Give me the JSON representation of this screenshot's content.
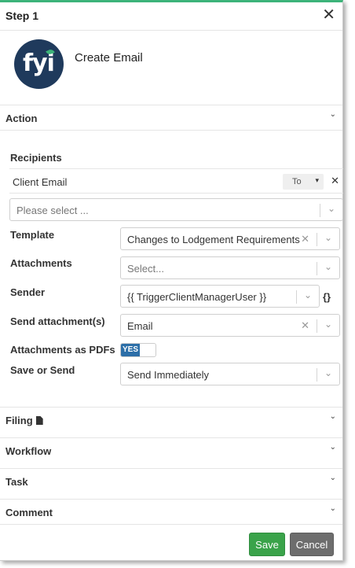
{
  "header": {
    "title": "Step 1",
    "close_icon": "close-icon"
  },
  "action_card": {
    "title": "Create Email",
    "logo_text": "fyi"
  },
  "sections": {
    "action": "Action",
    "filing": "Filing",
    "workflow": "Workflow",
    "task": "Task",
    "comment": "Comment"
  },
  "recipients": {
    "heading": "Recipients",
    "items": [
      {
        "name": "Client Email",
        "type": "To"
      }
    ],
    "select_placeholder": "Please select ..."
  },
  "form": {
    "template": {
      "label": "Template",
      "value": "Changes to Lodgement Requirements"
    },
    "attachments": {
      "label": "Attachments",
      "placeholder": "Select..."
    },
    "sender": {
      "label": "Sender",
      "value": "{{ TriggerClientManagerUser }}"
    },
    "send_attachments": {
      "label": "Send attachment(s)",
      "value": "Email"
    },
    "attachments_pdf": {
      "label": "Attachments as PDFs",
      "toggle_text": "YES",
      "on": true
    },
    "save_or_send": {
      "label": "Save or Send",
      "value": "Send Immediately"
    }
  },
  "buttons": {
    "save": "Save",
    "cancel": "Cancel"
  },
  "glyphs": {
    "close": "✕",
    "x": "✕",
    "chevron": "⌄",
    "caret": "▾",
    "braces": "{}"
  },
  "colors": {
    "accent_bar": "#3db37a",
    "save": "#3aa34a",
    "cancel": "#6d6d6d",
    "toggle_on": "#2c6fa8",
    "logo_bg": "#1f3a5c"
  }
}
